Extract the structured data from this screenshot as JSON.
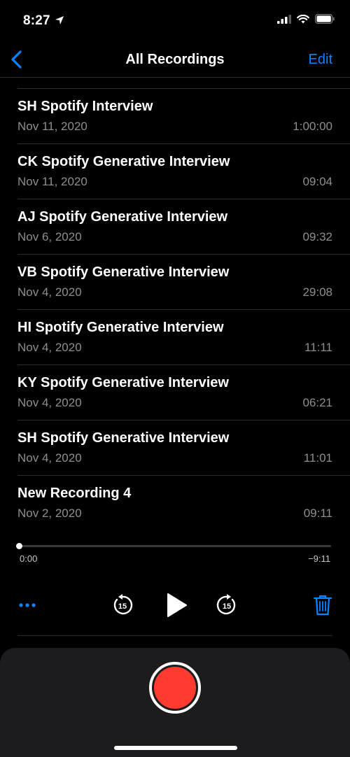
{
  "status": {
    "time": "8:27",
    "icons": [
      "location-arrow-icon",
      "cellular-signal-icon",
      "wifi-icon",
      "battery-icon"
    ]
  },
  "nav": {
    "back_icon": "chevron-left-icon",
    "title": "All Recordings",
    "edit_label": "Edit",
    "accent_color": "#0a84ff"
  },
  "recordings": [
    {
      "title": "SH Spotify Interview",
      "date": "Nov 11, 2020",
      "duration": "1:00:00"
    },
    {
      "title": "CK Spotify Generative Interview",
      "date": "Nov 11, 2020",
      "duration": "09:04"
    },
    {
      "title": "AJ Spotify Generative Interview",
      "date": "Nov 6, 2020",
      "duration": "09:32"
    },
    {
      "title": "VB Spotify Generative Interview",
      "date": "Nov 4, 2020",
      "duration": "29:08"
    },
    {
      "title": "HI Spotify Generative Interview",
      "date": "Nov 4, 2020",
      "duration": "11:11"
    },
    {
      "title": "KY Spotify Generative Interview",
      "date": "Nov 4, 2020",
      "duration": "06:21"
    },
    {
      "title": "SH Spotify Generative Interview",
      "date": "Nov 4, 2020",
      "duration": "11:01"
    },
    {
      "title": "New Recording 4",
      "date": "Nov 2, 2020",
      "duration": "09:11"
    }
  ],
  "player": {
    "elapsed": "0:00",
    "remaining": "−9:11",
    "progress": 0,
    "controls": {
      "more": "more-options-icon",
      "skip_back": "skip-back-15-icon",
      "play": "play-icon",
      "skip_forward": "skip-forward-15-icon",
      "delete": "trash-icon"
    },
    "skip_seconds": "15"
  },
  "record": {
    "icon": "record-icon",
    "color": "#ff3b30"
  }
}
